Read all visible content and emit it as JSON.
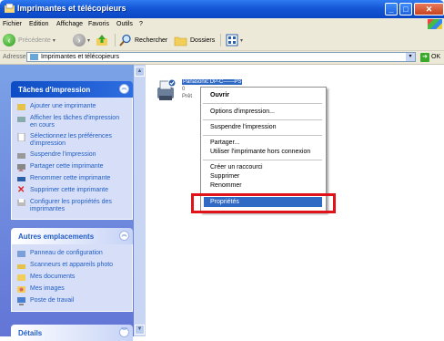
{
  "window": {
    "title": "Imprimantes et télécopieurs"
  },
  "menu": [
    "Fichier",
    "Edition",
    "Affichage",
    "Favoris",
    "Outils",
    "?"
  ],
  "toolbar": {
    "back": "Précédente",
    "search": "Rechercher",
    "folders": "Dossiers"
  },
  "address": {
    "label": "Adresse",
    "value": "Imprimantes et télécopieurs",
    "go": "OK"
  },
  "tasks": {
    "title": "Tâches d'impression",
    "items": [
      "Ajouter une imprimante",
      "Afficher les tâches d'impression en cours",
      "Sélectionnez les préférences d'impression",
      "Suspendre l'impression",
      "Partager cette imprimante",
      "Renommer cette imprimante",
      "Supprimer cette imprimante",
      "Configurer les propriétés des imprimantes"
    ]
  },
  "other": {
    "title": "Autres emplacements",
    "items": [
      "Panneau de configuration",
      "Scanneurs et appareils photo",
      "Mes documents",
      "Mes images",
      "Poste de travail"
    ]
  },
  "details": {
    "title": "Détails"
  },
  "printer": {
    "name": "Panasonic DP-C——PS",
    "count": "0",
    "status": "Prêt"
  },
  "context_menu": {
    "open": "Ouvrir",
    "print_options": "Options d'impression...",
    "pause": "Suspendre l'impression",
    "share": "Partager...",
    "offline": "Utiliser l'imprimante hors connexion",
    "shortcut": "Créer un raccourci",
    "delete": "Supprimer",
    "rename": "Renommer",
    "properties": "Propriétés"
  }
}
